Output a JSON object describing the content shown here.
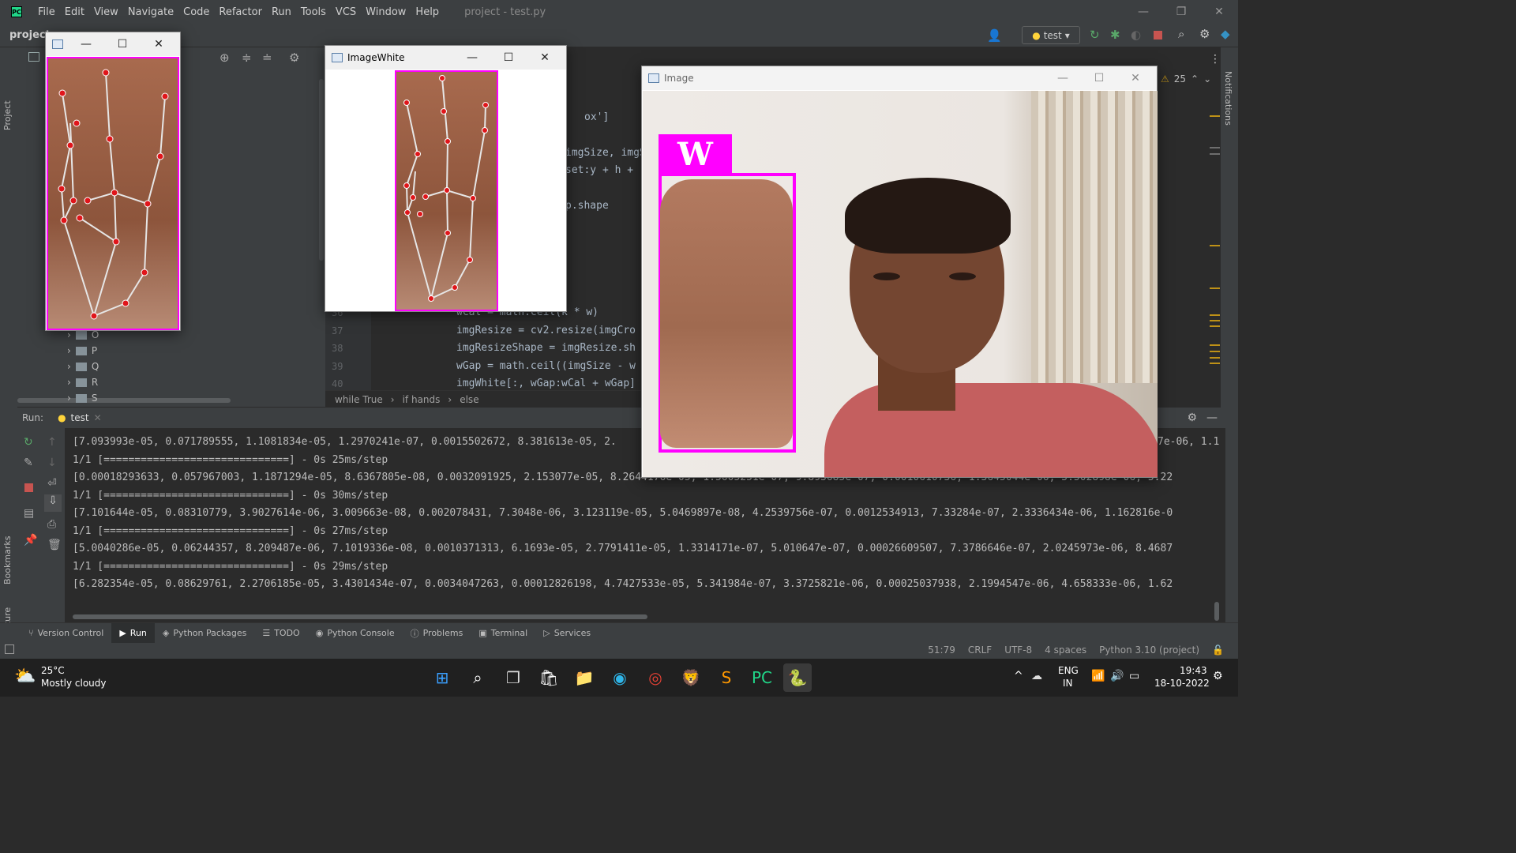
{
  "menubar": {
    "items": [
      "File",
      "Edit",
      "View",
      "Navigate",
      "Code",
      "Refactor",
      "Run",
      "Tools",
      "VCS",
      "Window",
      "Help"
    ],
    "title": "project - test.py"
  },
  "toolbar": {
    "project_label": "project",
    "run_config": "test",
    "inspection_count": "25"
  },
  "project_tree": [
    "O",
    "P",
    "Q",
    "R",
    "S"
  ],
  "editor": {
    "line_numbers": [
      "36",
      "37",
      "38",
      "39",
      "40"
    ],
    "code_lines": [
      "wCal = math.ceil(k * w)",
      "imgResize = cv2.resize(imgCro",
      "imgResizeShape = imgResize.sh",
      "wGap = math.ceil((imgSize - w",
      "imgWhite[:, wGap:wCal + wGap]"
    ],
    "partial_lines": [
      "ox']",
      "imgSize, imgS",
      "set:y + h +",
      "p.shape"
    ],
    "breadcrumb": [
      "while True",
      "if hands",
      "else"
    ]
  },
  "run_panel": {
    "label": "Run:",
    "tab": "test",
    "output": [
      "[7.093993e-05, 0.071789555, 1.1081834e-05, 1.2970241e-07, 0.0015502672, 8.381613e-05, 2.",
      "1/1 [==============================] - 0s 25ms/step",
      "[0.00018293633, 0.057967003, 1.1871294e-05, 8.6367805e-08, 0.0032091925, 2.153077e-05, 8.2644176e-05, 1.5605251e-07, 9.893685e-07, 0.0010610736, 1.3645044e-06, 5.502898e-06, 5.22",
      "1/1 [==============================] - 0s 30ms/step",
      "[7.101644e-05, 0.08310779, 3.9027614e-06, 3.009663e-08, 0.002078431, 7.3048e-06, 3.123119e-05, 5.0469897e-08, 4.2539756e-07, 0.0012534913, 7.33284e-07, 2.3336434e-06, 1.162816e-0",
      "1/1 [==============================] - 0s 27ms/step",
      "[5.0040286e-05, 0.06244357, 8.209487e-06, 7.1019336e-08, 0.0010371313, 6.1693e-05, 2.7791411e-05, 1.3314171e-07, 5.010647e-07, 0.00026609507, 7.3786646e-07, 2.0245973e-06, 8.4687",
      "1/1 [==============================] - 0s 29ms/step",
      "[6.282354e-05, 0.08629761, 2.2706185e-05, 3.4301434e-07, 0.0034047263, 0.00012826198, 4.7427533e-05, 5.341984e-07, 3.3725821e-06, 0.00025037938, 2.1994547e-06, 4.658333e-06, 1.62"
    ],
    "right_overflow": "7e-06, 1.1"
  },
  "bottom_tabs": [
    "Version Control",
    "Run",
    "Python Packages",
    "TODO",
    "Python Console",
    "Problems",
    "Terminal",
    "Services"
  ],
  "statusbar": {
    "position": "51:79",
    "line_sep": "CRLF",
    "encoding": "UTF-8",
    "indent": "4 spaces",
    "interpreter": "Python 3.10 (project)"
  },
  "side_labels": {
    "project": "Project",
    "bookmarks": "Bookmarks",
    "structure": "Structure",
    "notifications": "Notifications"
  },
  "windows": {
    "image_white": {
      "title": "ImageWhite"
    },
    "image": {
      "title": "Image",
      "prediction": "W"
    }
  },
  "taskbar": {
    "weather_temp": "25°C",
    "weather_desc": "Mostly cloudy",
    "lang": "ENG",
    "region": "IN",
    "time": "19:43",
    "date": "18-10-2022"
  },
  "colors": {
    "accent_box": "#ff00ff",
    "landmark": "#e0151a",
    "ide_bg": "#2b2b2b",
    "panel_bg": "#3c3f41"
  }
}
